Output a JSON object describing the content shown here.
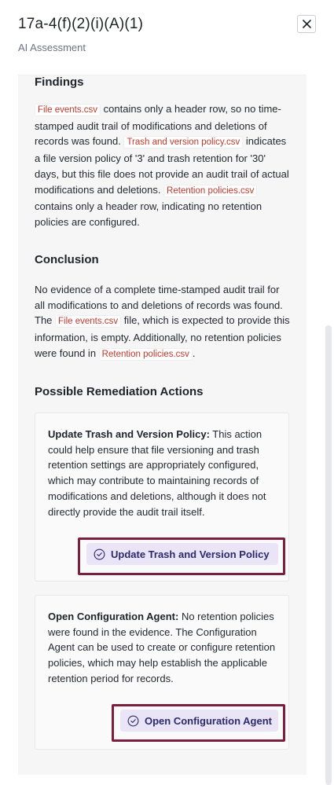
{
  "header": {
    "title": "17a-4(f)(2)(i)(A)(1)",
    "subtitle": "AI Assessment",
    "close_icon": "close-icon"
  },
  "findings": {
    "heading": "Findings",
    "file_events": "File events.csv",
    "text_1": " contains only a header row, so no time-stamped audit trail of modifications and deletions of records was found. ",
    "trash_policy": "Trash and version policy.csv",
    "text_2": " indicates a file version policy of '3' and trash retention for '30' days, but this file does not provide an audit trail of actual modifications and deletions. ",
    "retention_policies": "Retention policies.csv",
    "text_3": " contains only a header row, indicating no retention policies are configured."
  },
  "conclusion": {
    "heading": "Conclusion",
    "text_1": "No evidence of a complete time-stamped audit trail for all modifications to and deletions of records was found. The ",
    "file_events": "File events.csv",
    "text_2": " file, which is expected to provide this information, is empty. Additionally, no retention policies were found in ",
    "retention_policies": "Retention policies.csv",
    "text_3": "."
  },
  "remediation": {
    "heading": "Possible Remediation Actions",
    "actions": [
      {
        "title": "Update Trash and Version Policy:",
        "description": " This action could help ensure that file versioning and trash retention settings are appropriately configured, which may contribute to maintaining records of modifications and deletions, although it does not directly provide the audit trail itself.",
        "button_label": "Update Trash and Version Policy",
        "button_icon": "check-circle-icon"
      },
      {
        "title": "Open Configuration Agent:",
        "description": " No retention policies were found in the evidence. The Configuration Agent can be used to create or configure retention policies, which may help establish the applicable retention period for records.",
        "button_label": "Open Configuration Agent",
        "button_icon": "check-circle-icon"
      }
    ]
  },
  "colors": {
    "accent_button_bg": "#e9e5f7",
    "accent_button_text": "#2c2a6b",
    "highlight_outline": "#7a1f3d",
    "code_text": "#c0392b"
  }
}
